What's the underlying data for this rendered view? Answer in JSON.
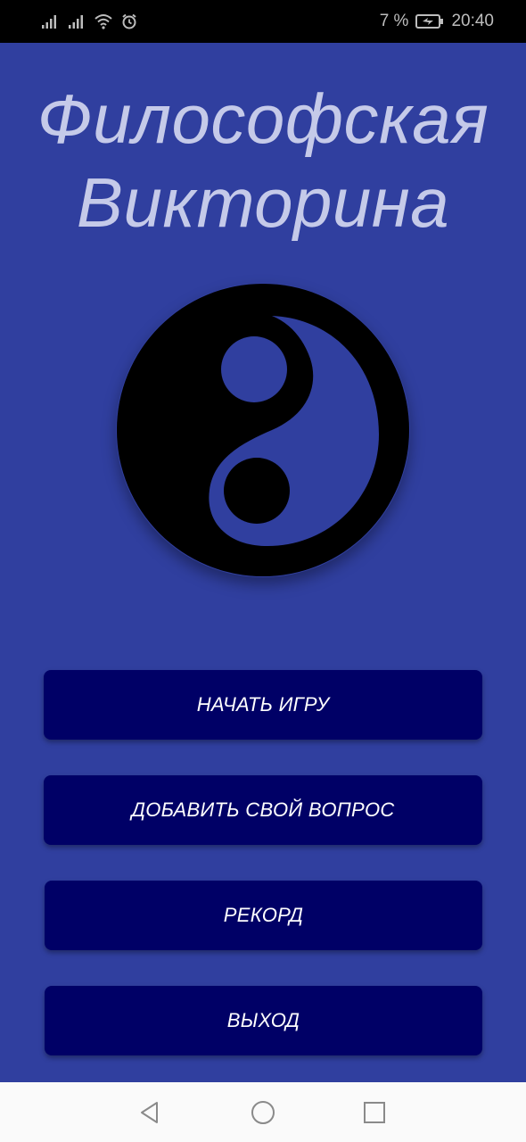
{
  "status_bar": {
    "battery_percent": "7 %",
    "time": "20:40",
    "icons": [
      "signal-icon",
      "signal-icon",
      "wifi-icon",
      "alarm-icon",
      "battery-charging-icon"
    ]
  },
  "title": {
    "line1": "Философская",
    "line2": "Викторина"
  },
  "logo": {
    "icon": "yin-yang-icon"
  },
  "buttons": {
    "start": "НАЧАТЬ ИГРУ",
    "add_question": "ДОБАВИТЬ СВОЙ ВОПРОС",
    "record": "РЕКОРД",
    "exit": "ВЫХОД"
  },
  "nav_bar": {
    "icons": [
      "back-icon",
      "home-icon",
      "recent-apps-icon"
    ]
  },
  "colors": {
    "background": "#303f9f",
    "title": "#c5cae9",
    "button": "#000066",
    "button_text": "#ffffff",
    "logo_dark": "#000000"
  }
}
